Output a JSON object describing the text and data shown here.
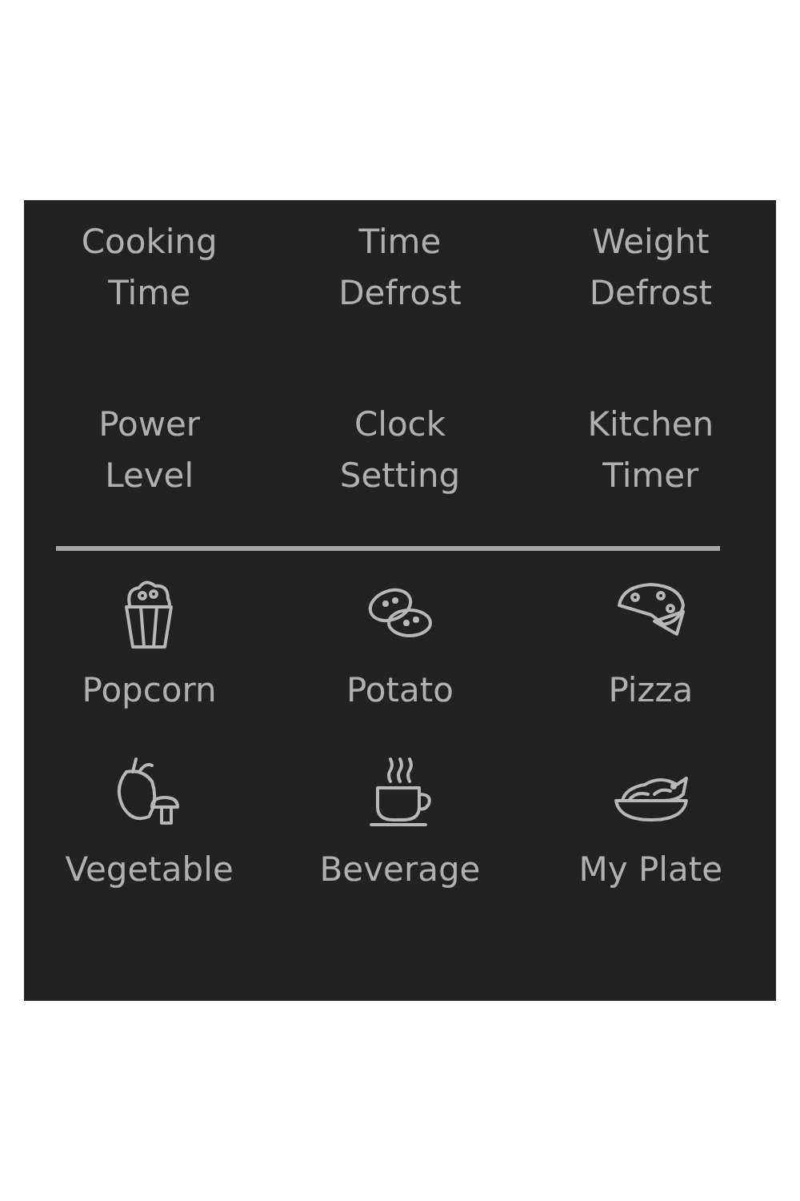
{
  "function_keys": [
    {
      "label": "Cooking Time"
    },
    {
      "label": "Time Defrost"
    },
    {
      "label": "Weight Defrost"
    },
    {
      "label": "Power Level"
    },
    {
      "label": "Clock Setting"
    },
    {
      "label": "Kitchen Timer"
    }
  ],
  "food_keys": [
    {
      "kind": "popcorn",
      "label": "Popcorn"
    },
    {
      "kind": "potato",
      "label": "Potato"
    },
    {
      "kind": "pizza",
      "label": "Pizza"
    },
    {
      "kind": "vegetable",
      "label": "Vegetable"
    },
    {
      "kind": "beverage",
      "label": "Beverage"
    },
    {
      "kind": "plate",
      "label": "My Plate"
    }
  ]
}
